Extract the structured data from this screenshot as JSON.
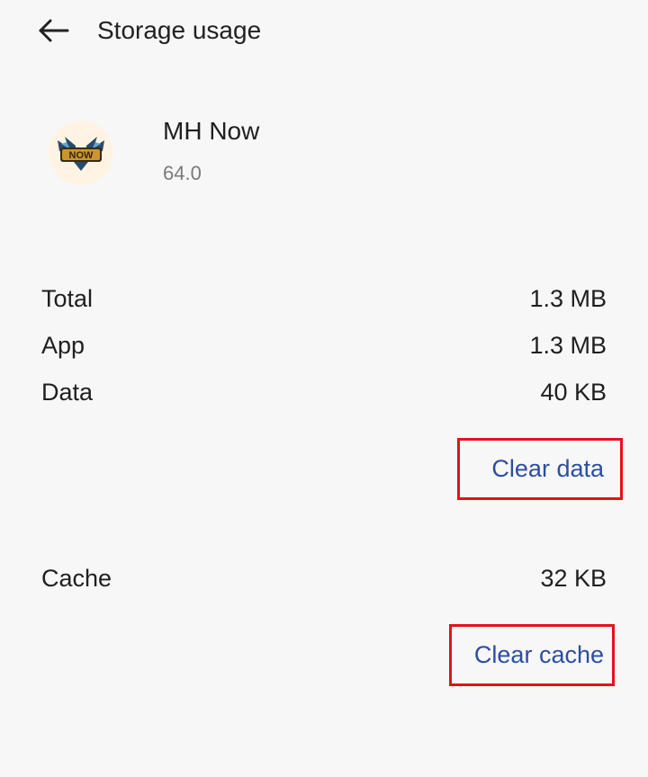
{
  "header": {
    "back_icon": "arrow-left-icon",
    "title": "Storage usage"
  },
  "app": {
    "icon": "mh-now-app-icon",
    "icon_text": "NOW",
    "name": "MH Now",
    "version": "64.0"
  },
  "storage": {
    "rows": [
      {
        "label": "Total",
        "value": "1.3 MB"
      },
      {
        "label": "App",
        "value": "1.3 MB"
      },
      {
        "label": "Data",
        "value": "40 KB"
      }
    ],
    "clear_data_label": "Clear data",
    "cache_label": "Cache",
    "cache_value": "32 KB",
    "clear_cache_label": "Clear cache"
  },
  "colors": {
    "background": "#f7f7f7",
    "action_text": "#2b4f9e",
    "highlight_box": "#e3131b"
  }
}
